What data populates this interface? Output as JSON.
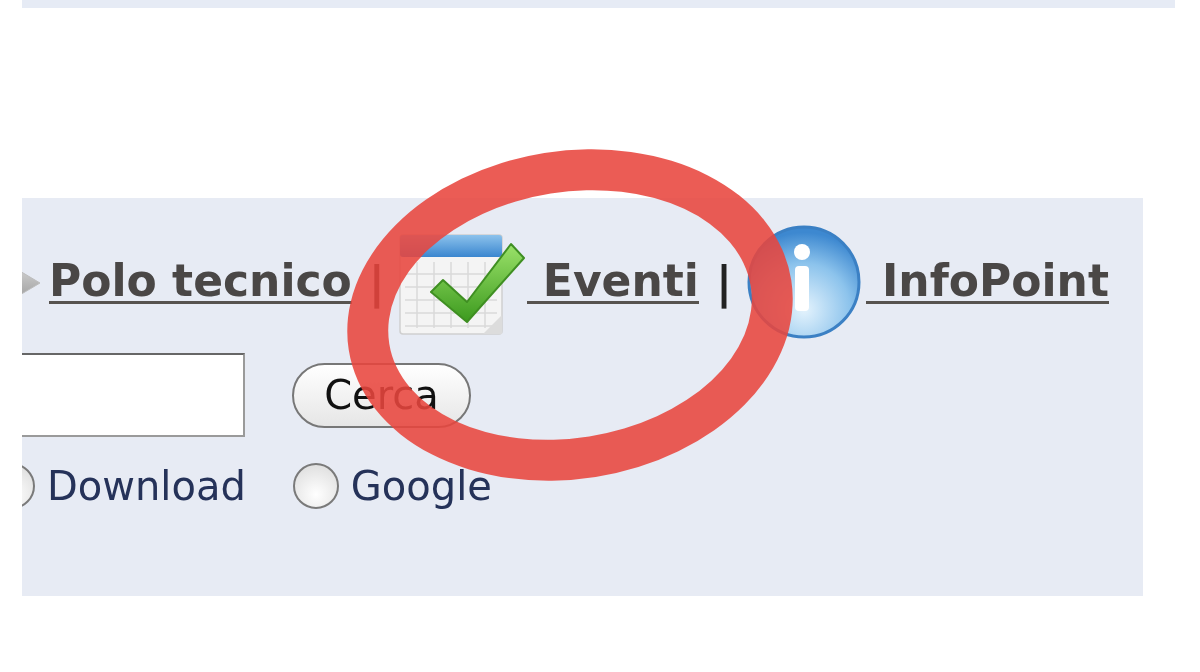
{
  "nav": [
    {
      "kind": "link",
      "label": "Polo tecnico"
    },
    {
      "kind": "separator",
      "text": "|"
    },
    {
      "kind": "link",
      "label": "Eventi"
    },
    {
      "kind": "separator",
      "text": "|"
    },
    {
      "kind": "link",
      "label": "InfoPoint"
    }
  ],
  "search": {
    "button": "Cerca",
    "options": [
      {
        "label": "Download",
        "selected": false
      },
      {
        "label": "Google",
        "selected": false
      }
    ]
  },
  "annotation": {
    "kind": "ellipse"
  }
}
